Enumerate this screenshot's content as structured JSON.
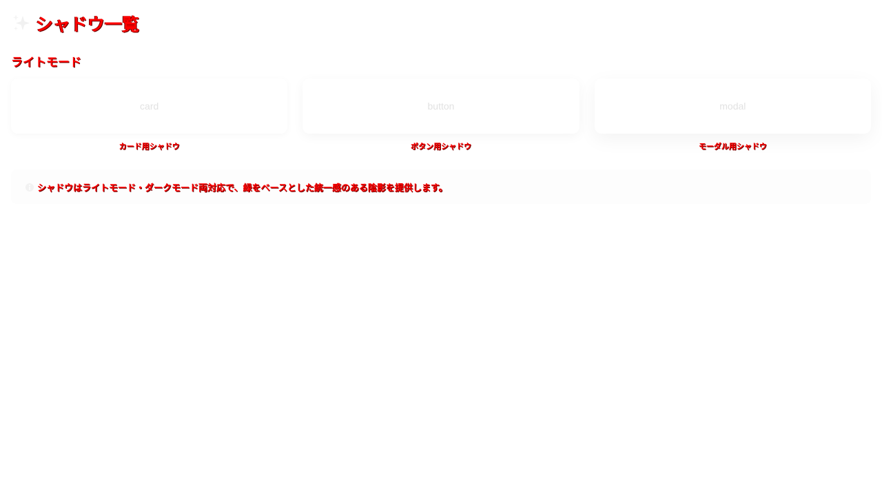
{
  "header": {
    "icon": "sparkles-icon",
    "title": "シャドウ一覧"
  },
  "section": {
    "title": "ライトモード"
  },
  "samples": [
    {
      "inner": "card",
      "label": "カード用シャドウ"
    },
    {
      "inner": "button",
      "label": "ボタン用シャドウ"
    },
    {
      "inner": "modal",
      "label": "モーダル用シャドウ"
    }
  ],
  "note": {
    "icon": "info-icon",
    "text": "シャドウはライトモード・ダークモード両対応で、緑をベースとした統一感のある陰影を提供します。"
  },
  "colors": {
    "heading": "#ff0000",
    "heading_outline": "#6b0000",
    "sample_text": "#e2e2e2",
    "background": "#ffffff"
  }
}
